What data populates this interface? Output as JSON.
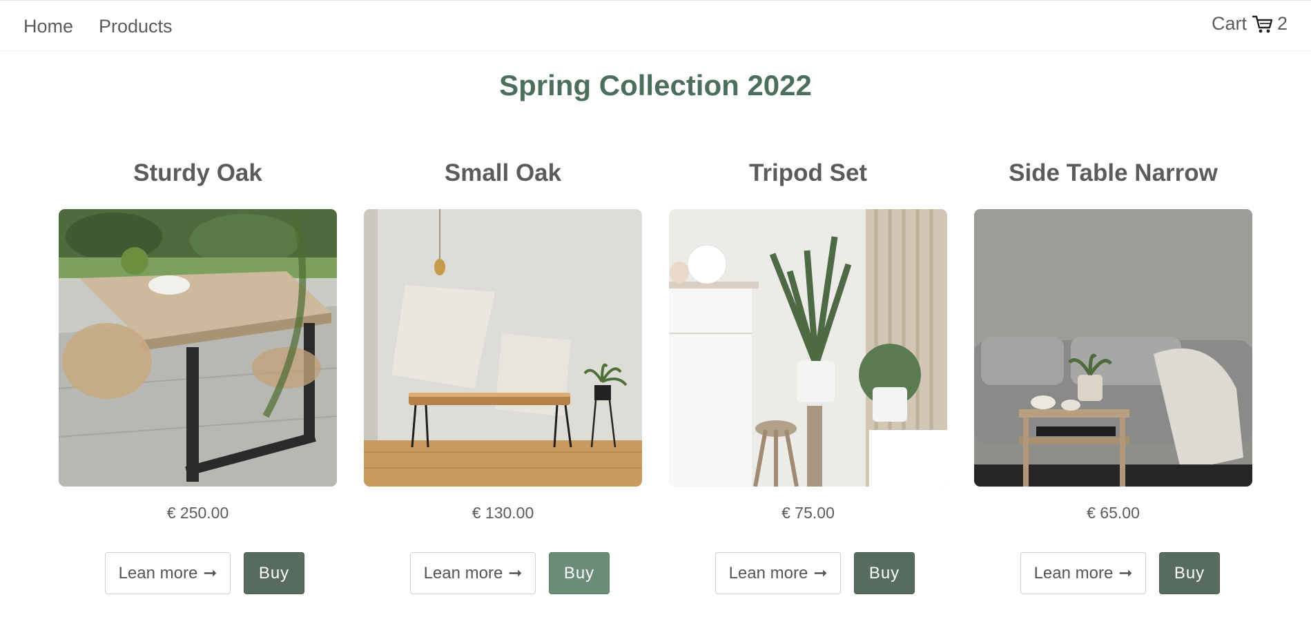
{
  "nav": {
    "home_label": "Home",
    "products_label": "Products",
    "cart_label": "Cart",
    "cart_count": "2",
    "cart_icon": "shopping-cart-icon"
  },
  "page": {
    "title": "Spring Collection 2022"
  },
  "colors": {
    "title": "#4c6e5c",
    "buy_button": "#576b5f",
    "buy_button_active": "#6b8c78"
  },
  "products": [
    {
      "name": "Sturdy Oak",
      "price": "€ 250.00",
      "learn_label": "Lean more",
      "buy_label": "Buy",
      "image": "dining-table-photo"
    },
    {
      "name": "Small Oak",
      "price": "€ 130.00",
      "learn_label": "Lean more",
      "buy_label": "Buy",
      "image": "console-table-photo"
    },
    {
      "name": "Tripod Set",
      "price": "€ 75.00",
      "learn_label": "Lean more",
      "buy_label": "Buy",
      "image": "plant-stools-photo"
    },
    {
      "name": "Side Table Narrow",
      "price": "€ 65.00",
      "learn_label": "Lean more",
      "buy_label": "Buy",
      "image": "sofa-side-table-photo"
    }
  ]
}
